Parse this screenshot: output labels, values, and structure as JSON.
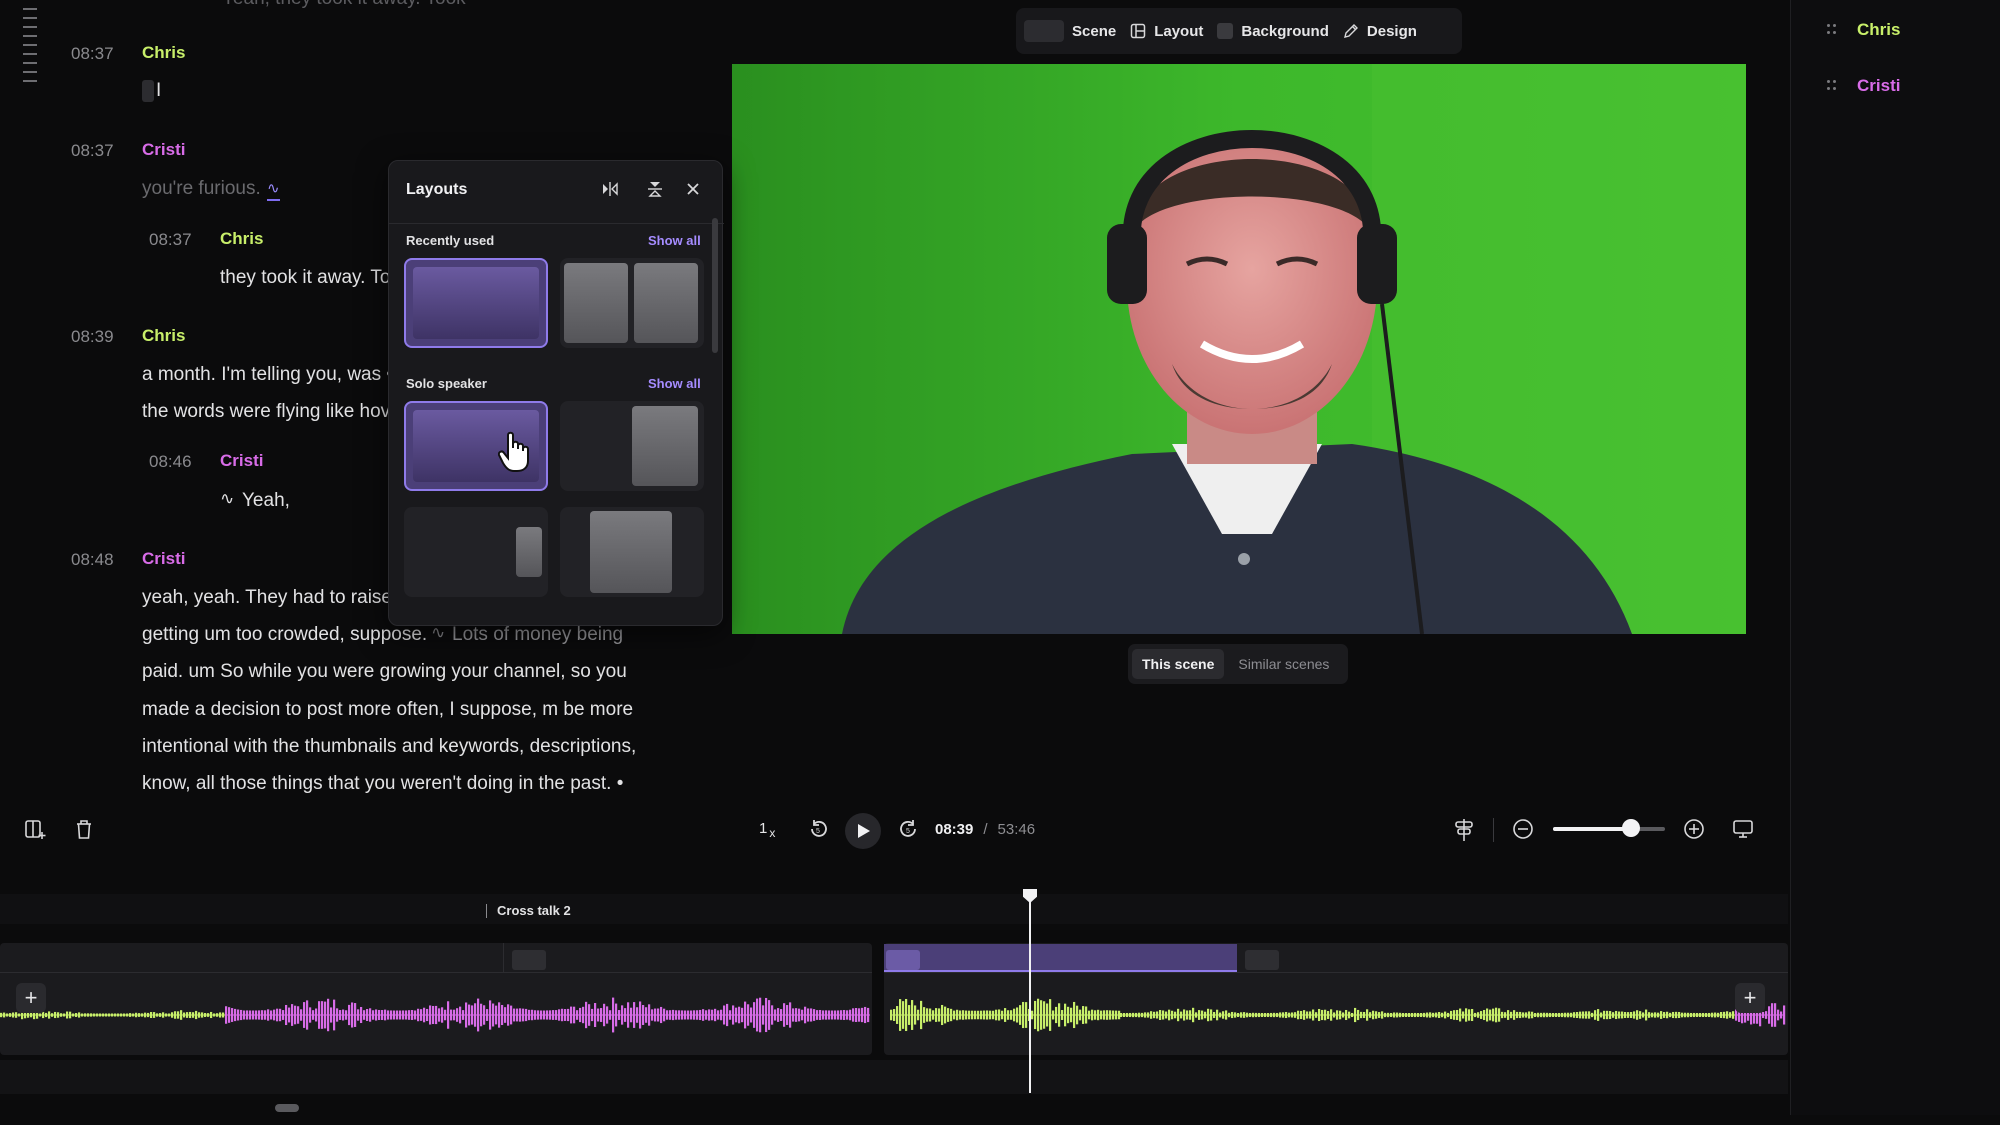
{
  "transcript": {
    "top_cut_line": "Yeah, they took it away. Took",
    "entries": [
      {
        "time": "08:37",
        "speaker": "Chris",
        "lines": [
          "I"
        ]
      },
      {
        "time": "08:37",
        "speaker": "Cristi",
        "lines": [
          "you're furious."
        ]
      },
      {
        "time": "08:37",
        "speaker": "Chris",
        "lines": [
          "they took it away. To"
        ]
      },
      {
        "time": "08:39",
        "speaker": "Chris",
        "lines": [
          "a month. I'm telling you, was •",
          "the words were flying like hov"
        ]
      },
      {
        "time": "08:46",
        "speaker": "Cristi",
        "lines": [
          "Yeah,"
        ]
      },
      {
        "time": "08:48",
        "speaker": "Cristi",
        "lines": [
          "yeah, yeah. They had to raise",
          "getting um too crowded, suppose.",
          "Lots of money being",
          "paid. um So while you were growing your channel, so you",
          "made a decision to post more often, I suppose, m be more",
          "intentional with the thumbnails and keywords,  descriptions,",
          "know,  all those things that you weren't doing in the past. •"
        ]
      }
    ]
  },
  "toolbar": {
    "scene_label": "Scene",
    "layout_label": "Layout",
    "background_label": "Background",
    "design_label": "Design"
  },
  "layouts_panel": {
    "title": "Layouts",
    "recently_used_label": "Recently used",
    "solo_speaker_label": "Solo speaker",
    "show_all_label": "Show all"
  },
  "scene_toggle": {
    "this_scene": "This scene",
    "similar_scenes": "Similar scenes"
  },
  "speakers_panel": {
    "items": [
      {
        "name": "Chris",
        "color": "#c8ef6a"
      },
      {
        "name": "Cristi",
        "color": "#d86ce8"
      }
    ]
  },
  "controls": {
    "speed": "1",
    "speed_suffix": "x",
    "current_time": "08:39",
    "separator": "/",
    "total_time": "53:46",
    "zoom_level": 0.7
  },
  "timeline": {
    "marker_label": "Cross talk 2"
  },
  "colors": {
    "chris": "#c8ef6a",
    "cristi": "#d86ce8",
    "accent": "#8f7bea"
  }
}
